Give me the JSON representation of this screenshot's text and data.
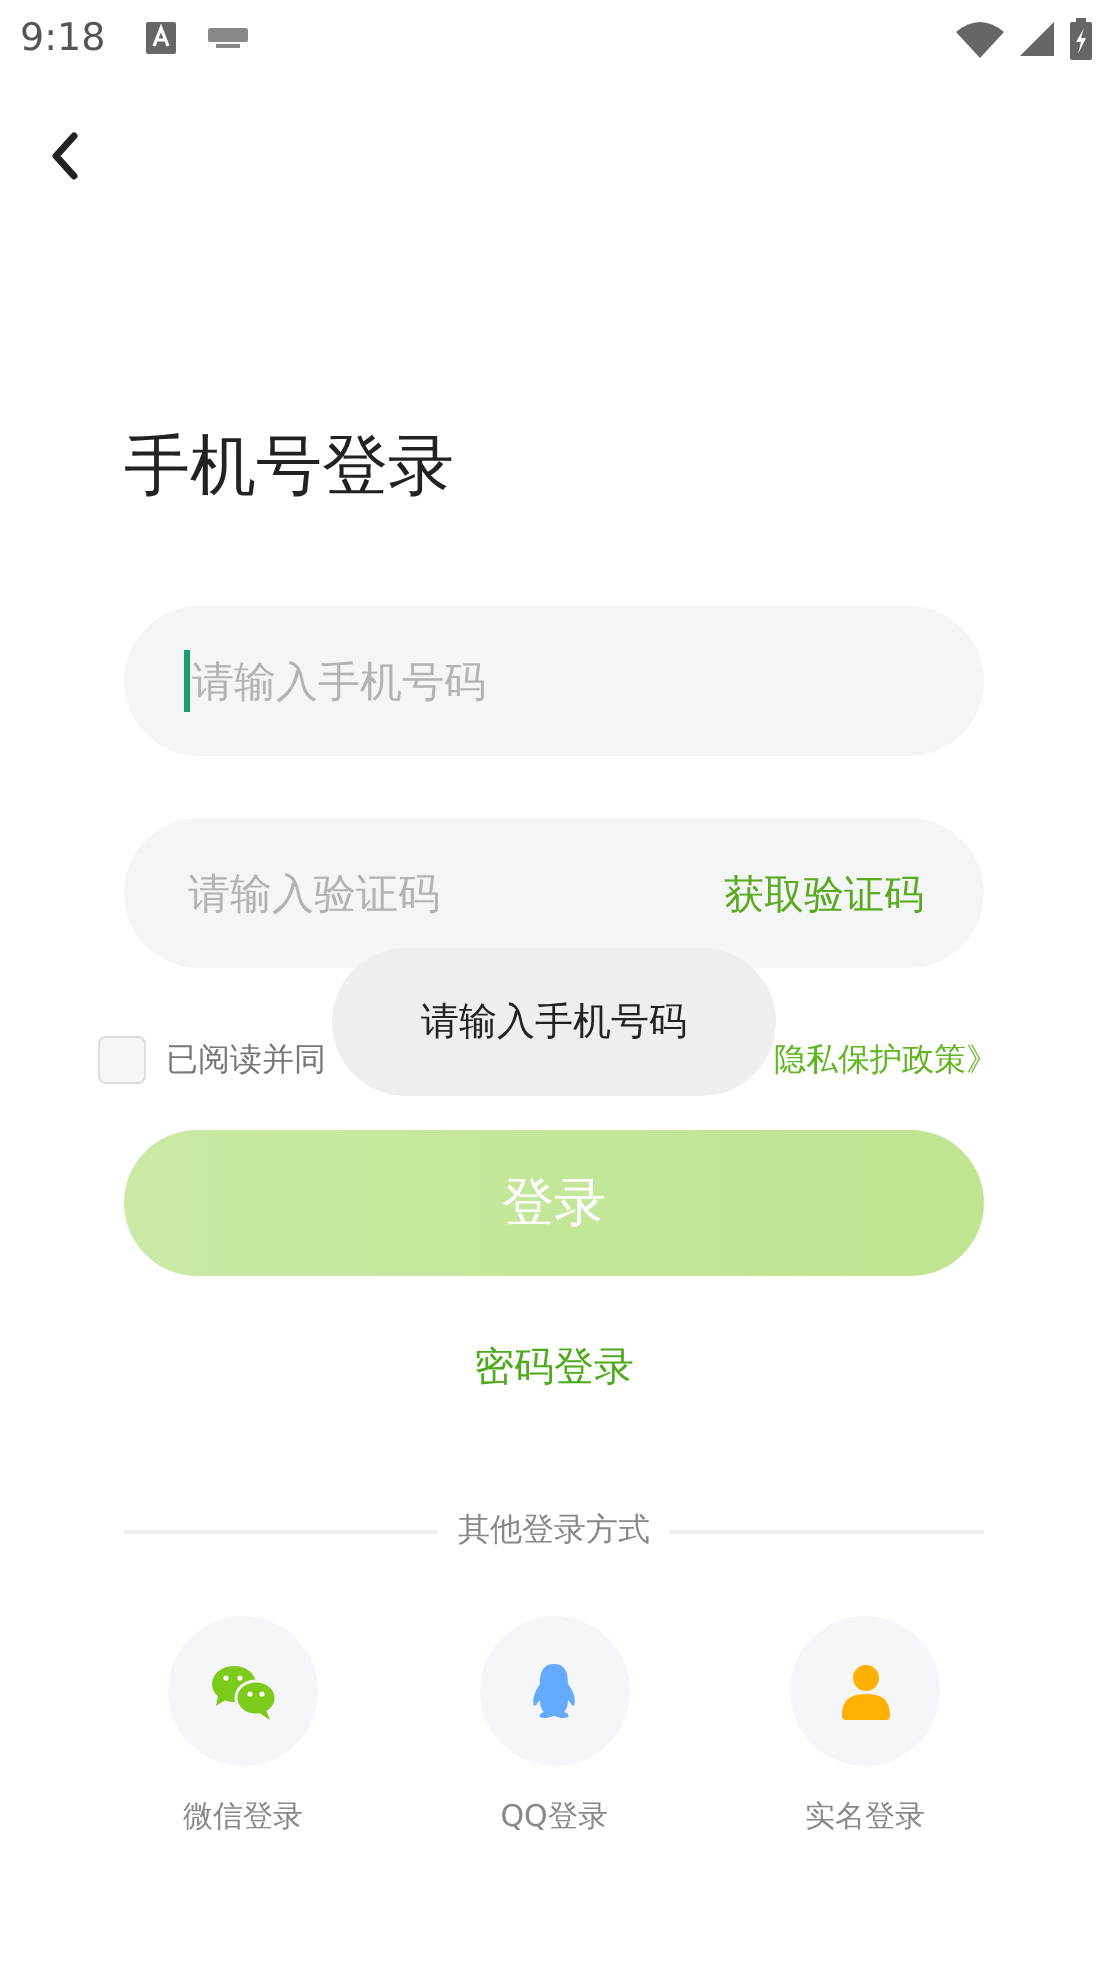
{
  "status_bar": {
    "time": "9:18"
  },
  "title": "手机号登录",
  "phone_field": {
    "placeholder": "请输入手机号码",
    "focused": true
  },
  "code_field": {
    "placeholder": "请输入验证码",
    "action": "获取验证码"
  },
  "agreement": {
    "checked": false,
    "prefix": "已阅读并同",
    "links": "隐私保护政策》"
  },
  "login_button": {
    "label": "登录",
    "disabled": true
  },
  "password_login": "密码登录",
  "other_methods": {
    "heading": "其他登录方式",
    "items": [
      {
        "kind": "wechat",
        "label": "微信登录"
      },
      {
        "kind": "qq",
        "label": "QQ登录"
      },
      {
        "kind": "person",
        "label": "实名登录"
      }
    ]
  },
  "toast": "请输入手机号码"
}
